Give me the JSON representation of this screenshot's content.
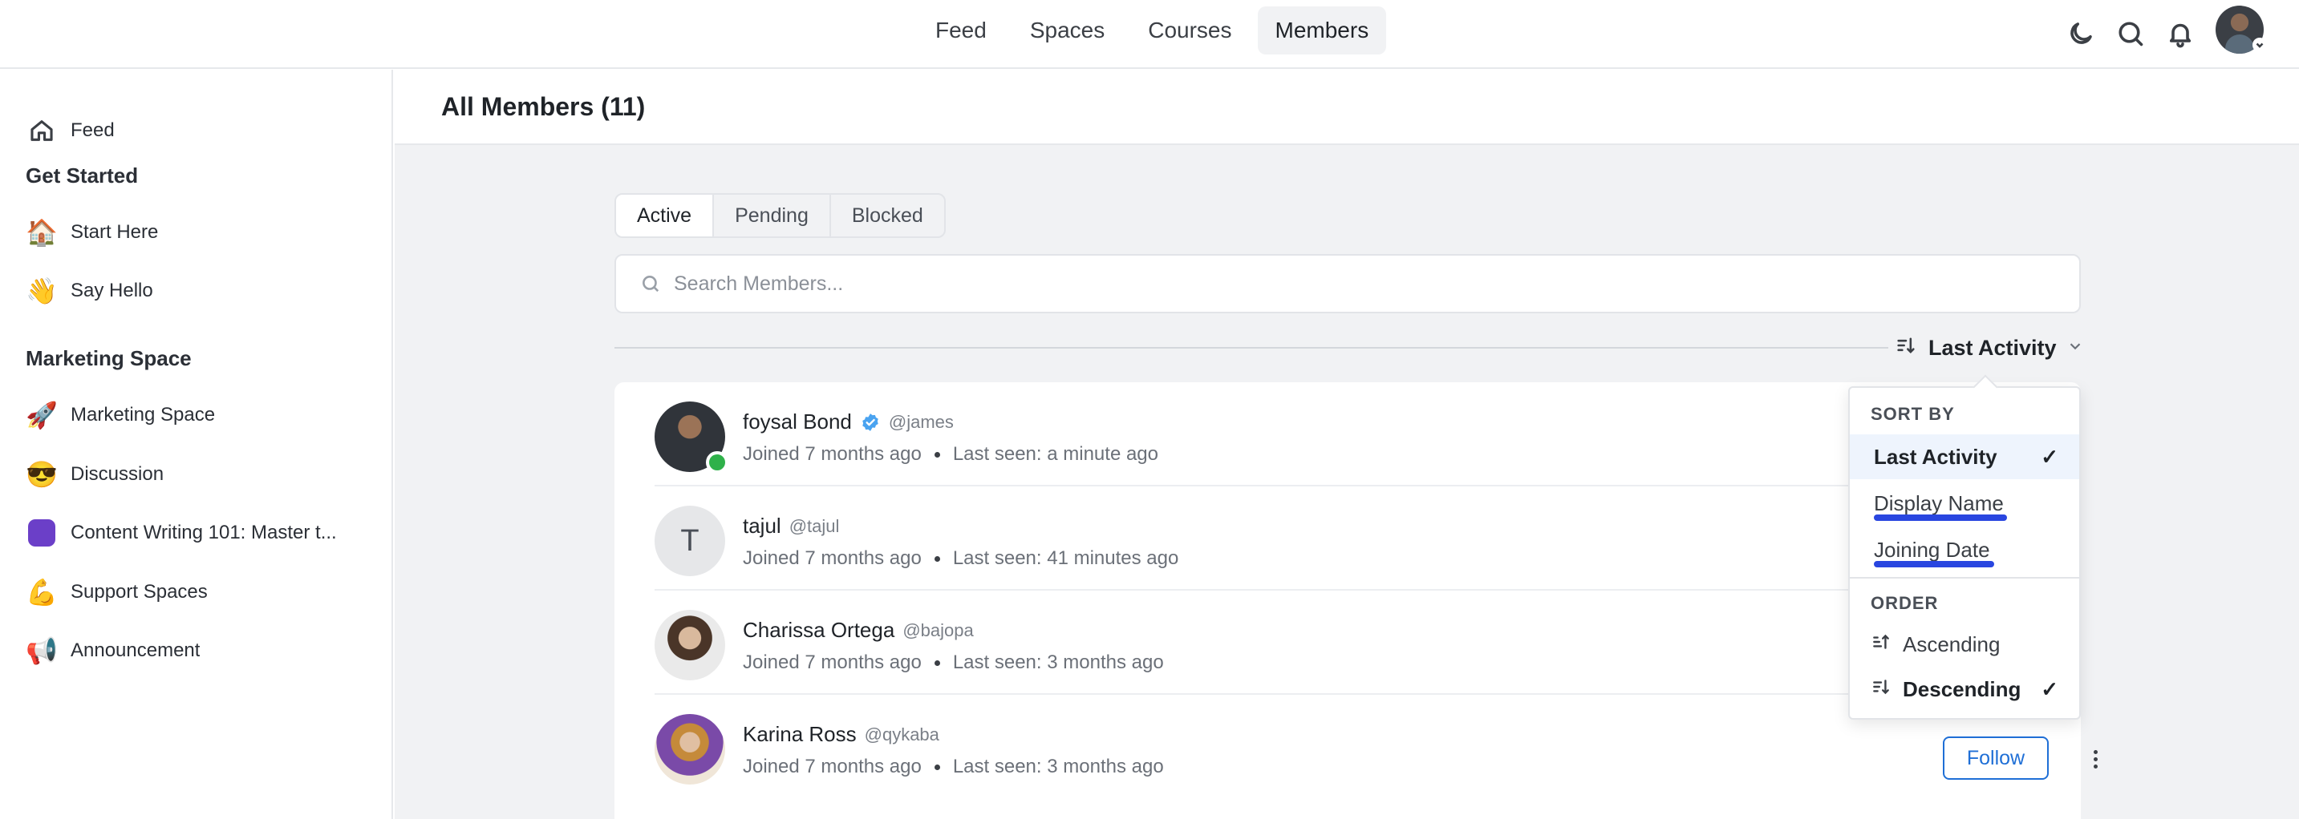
{
  "topnav": {
    "items": [
      {
        "label": "Feed"
      },
      {
        "label": "Spaces"
      },
      {
        "label": "Courses"
      },
      {
        "label": "Members"
      }
    ]
  },
  "icons": {
    "theme": "moon-icon",
    "search": "search-icon",
    "notifications": "bell-icon"
  },
  "sidebar": {
    "feed_label": "Feed",
    "groups": [
      {
        "heading": "Get Started",
        "items": [
          {
            "emoji": "🏠",
            "label": "Start Here"
          },
          {
            "emoji": "👋",
            "label": "Say Hello"
          }
        ]
      },
      {
        "heading": "Marketing Space",
        "items": [
          {
            "emoji": "🚀",
            "label": "Marketing Space"
          },
          {
            "emoji": "😎",
            "label": "Discussion"
          },
          {
            "emoji": "",
            "label": "Content Writing 101: Master t..."
          },
          {
            "emoji": "💪",
            "label": "Support Spaces"
          },
          {
            "emoji": "📢",
            "label": "Announcement"
          }
        ]
      }
    ]
  },
  "main": {
    "title": "All Members (11)",
    "tabs": [
      {
        "label": "Active"
      },
      {
        "label": "Pending"
      },
      {
        "label": "Blocked"
      }
    ],
    "search_placeholder": "Search Members...",
    "search_value": "",
    "sort_label": "Last Activity",
    "members": [
      {
        "name": "foysal Bond",
        "handle": "@james",
        "joined": "Joined 7 months ago",
        "last_seen": "Last seen: a minute ago",
        "verified": true,
        "online": true,
        "avatar_letter": ""
      },
      {
        "name": "tajul",
        "handle": "@tajul",
        "joined": "Joined 7 months ago",
        "last_seen": "Last seen: 41 minutes ago",
        "verified": false,
        "online": false,
        "avatar_letter": "T"
      },
      {
        "name": "Charissa Ortega",
        "handle": "@bajopa",
        "joined": "Joined 7 months ago",
        "last_seen": "Last seen: 3 months ago",
        "verified": false,
        "online": false,
        "avatar_letter": ""
      },
      {
        "name": "Karina Ross",
        "handle": "@qykaba",
        "joined": "Joined 7 months ago",
        "last_seen": "Last seen: 3 months ago",
        "verified": false,
        "online": false,
        "avatar_letter": ""
      }
    ],
    "follow_label": "Follow"
  },
  "sort_dropdown": {
    "sort_by_heading": "SORT BY",
    "sort_options": [
      {
        "label": "Last Activity",
        "selected": true
      },
      {
        "label": "Display Name",
        "selected": false
      },
      {
        "label": "Joining Date",
        "selected": false
      }
    ],
    "order_heading": "ORDER",
    "order_options": [
      {
        "label": "Ascending",
        "selected": false
      },
      {
        "label": "Descending",
        "selected": true
      }
    ],
    "check_glyph": "✓"
  },
  "colors": {
    "accent": "#1f6fd6",
    "online": "#2fb14a",
    "highlight_underline": "#2946e0",
    "selected_bg": "#eef4fd"
  }
}
